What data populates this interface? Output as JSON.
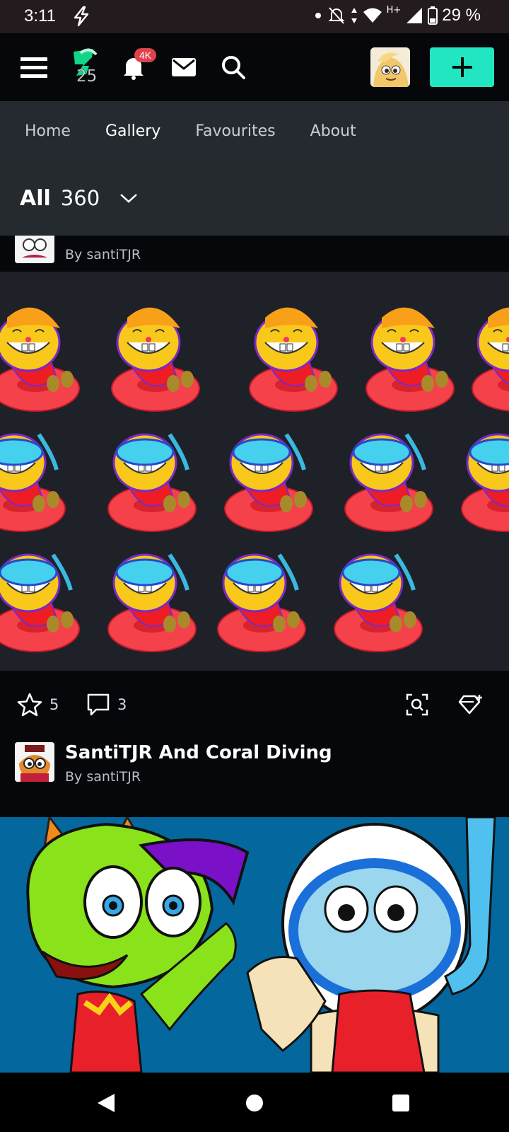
{
  "status_bar": {
    "time": "3:11",
    "network_type": "H+",
    "battery": "29 %"
  },
  "header": {
    "logo_number": "25",
    "notifications_badge": "4K",
    "icons": [
      "menu-icon",
      "deviantart-logo-icon",
      "bell-icon",
      "mail-icon",
      "search-icon"
    ],
    "create_label": "+"
  },
  "nav": {
    "tabs": [
      {
        "label": "Home",
        "active": false
      },
      {
        "label": "Gallery",
        "active": true
      },
      {
        "label": "Favourites",
        "active": false
      },
      {
        "label": "About",
        "active": false
      }
    ]
  },
  "filter": {
    "label": "All",
    "count": "360"
  },
  "posts": [
    {
      "title": "",
      "author": "By santiTJR",
      "favourites": "5",
      "comments": "3"
    },
    {
      "title": "SantiTJR And Coral Diving",
      "author": "By santiTJR"
    }
  ],
  "colors": {
    "accent": "#22e6c2",
    "badge": "#e0424b",
    "nav_bg": "#252a31",
    "filter_bg": "#242a2e"
  }
}
